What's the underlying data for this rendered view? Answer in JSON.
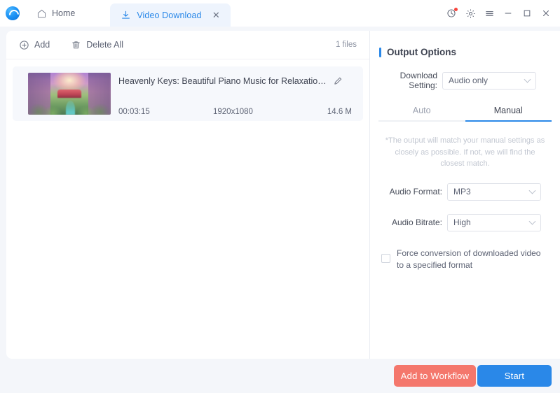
{
  "titlebar": {
    "logo_icon": "app-logo-icon",
    "home": {
      "label": "Home",
      "icon": "home-icon"
    },
    "tab": {
      "label": "Video Download",
      "icon": "download-icon",
      "close_icon": "close-icon"
    },
    "controls": {
      "history": "history-clock-icon",
      "settings": "gear-icon",
      "menu": "hamburger-menu-icon",
      "minimize": "minimize-icon",
      "maximize": "maximize-icon",
      "close": "window-close-icon"
    }
  },
  "toolbar": {
    "add_label": "Add",
    "add_icon": "plus-circle-icon",
    "delete_all_label": "Delete All",
    "delete_all_icon": "trash-icon",
    "file_count": "1 files"
  },
  "file": {
    "title": "Heavenly Keys: Beautiful Piano Music for Relaxation and Me...",
    "edit_icon": "pencil-edit-icon",
    "duration": "00:03:15",
    "resolution": "1920x1080",
    "size": "14.6 M",
    "thumbnail_alt": "fantasy landscape thumbnail"
  },
  "output_options": {
    "title": "Output Options",
    "accent_color": "#2a88e8",
    "download_setting": {
      "label": "Download Setting:",
      "value": "Audio only",
      "chevron_icon": "chevron-down-icon"
    },
    "mode_tabs": [
      {
        "label": "Auto",
        "active": false
      },
      {
        "label": "Manual",
        "active": true
      }
    ],
    "hint": "*The output will match your manual settings as closely as possible. If not, we will find the closest match.",
    "audio_format": {
      "label": "Audio Format:",
      "value": "MP3",
      "chevron_icon": "chevron-down-icon"
    },
    "audio_bitrate": {
      "label": "Audio Bitrate:",
      "value": "High",
      "chevron_icon": "chevron-down-icon"
    },
    "force_conversion": {
      "label": "Force conversion of downloaded video to a specified format",
      "checked": false
    }
  },
  "footer": {
    "add_to_workflow_label": "Add to Workflow",
    "add_to_workflow_color": "#f4776c",
    "start_label": "Start",
    "start_color": "#2a88e8"
  }
}
